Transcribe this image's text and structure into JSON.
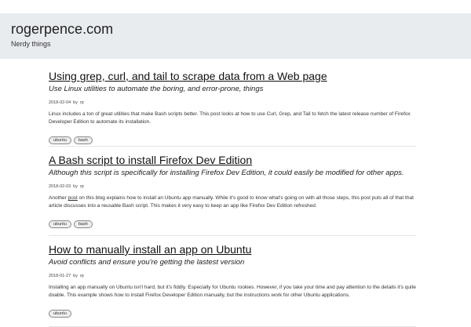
{
  "site": {
    "title": "rogerpence.com",
    "tagline": "Nerdy things"
  },
  "posts": [
    {
      "title": "Using grep, curl, and tail to scrape data from a Web page",
      "subtitle": "Use Linux utilities to automate the boring, and error-prone, things",
      "date": "2018-02-04",
      "by": "by",
      "author": "rp",
      "excerpt": "Linux includes a ton of great utilities that make Bash scripts better. This post looks at how to use Curl, Grep, and Tail to fetch the latest release number of Firefox Developer Edition to automate its installation.",
      "tags": [
        "ubuntu",
        "bash"
      ]
    },
    {
      "title": "A Bash script to install Firefox Dev Edition",
      "subtitle": "Although this script is specifically for installing Firefox Dev Edition, it could easily be modified for other apps.",
      "date": "2018-02-03",
      "by": "by",
      "author": "rp",
      "excerpt_before": "Another ",
      "excerpt_link": "post",
      "excerpt_after": " on this blog explains how to install an Ubuntu app manually. While it's good to know what's going on with all those steps, this post puts all of that that article discusses into a reusable Bash script. This makes it very easy to keep an app like Firefox Dev Edition refreshed.",
      "tags": [
        "ubuntu",
        "bash"
      ]
    },
    {
      "title": "How to manually install an app on Ubuntu",
      "subtitle": "Avoid conflicts and ensure you're getting the lastest version",
      "date": "2018-01-27",
      "by": "by",
      "author": "rp",
      "excerpt": "Installing an app manually on Ubuntu isn't hard, but it's fiddly. Especially for Ubuntu rookies. However, if you take your time and pay attention to the details it's quite doable. This example shows how to install Firefox Developer Edition manually, but the instructions work for other Ubuntu applications.",
      "tags": [
        "ubuntu"
      ]
    }
  ]
}
